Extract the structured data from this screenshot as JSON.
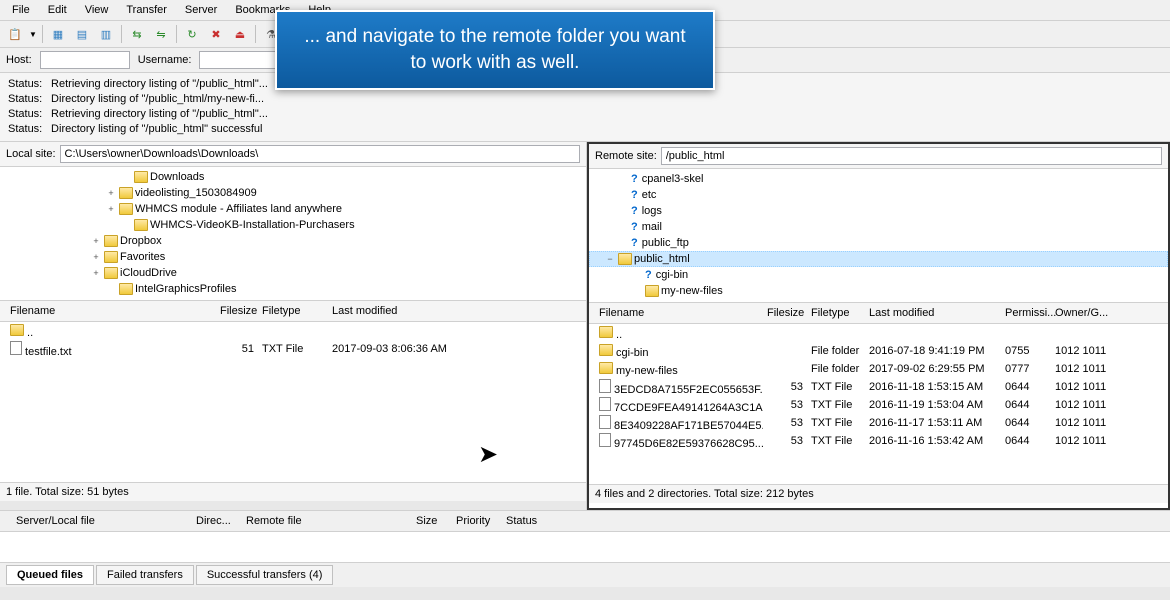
{
  "menu": {
    "file": "File",
    "edit": "Edit",
    "view": "View",
    "transfer": "Transfer",
    "server": "Server",
    "bookmarks": "Bookmarks",
    "help": "Help"
  },
  "qc": {
    "host_lbl": "Host:",
    "user_lbl": "Username:"
  },
  "log": [
    {
      "lbl": "Status:",
      "msg": "Retrieving directory listing of \"/public_html\"..."
    },
    {
      "lbl": "Status:",
      "msg": "Directory listing of \"/public_html/my-new-fi..."
    },
    {
      "lbl": "Status:",
      "msg": "Retrieving directory listing of \"/public_html\"..."
    },
    {
      "lbl": "Status:",
      "msg": "Directory listing of \"/public_html\" successful"
    }
  ],
  "local": {
    "path_lbl": "Local site:",
    "path": "C:\\Users\\owner\\Downloads\\Downloads\\",
    "tree": [
      {
        "indent": 120,
        "exp": "",
        "name": "Downloads"
      },
      {
        "indent": 105,
        "exp": "+",
        "name": "videolisting_1503084909"
      },
      {
        "indent": 105,
        "exp": "+",
        "name": "WHMCS module - Affiliates land anywhere"
      },
      {
        "indent": 120,
        "exp": "",
        "name": "WHMCS-VideoKB-Installation-Purchasers"
      },
      {
        "indent": 90,
        "exp": "+",
        "name": "Dropbox"
      },
      {
        "indent": 90,
        "exp": "+",
        "name": "Favorites"
      },
      {
        "indent": 90,
        "exp": "+",
        "name": "iCloudDrive"
      },
      {
        "indent": 105,
        "exp": "",
        "name": "IntelGraphicsProfiles"
      }
    ],
    "cols": {
      "name": "Filename",
      "size": "Filesize",
      "type": "Filetype",
      "mod": "Last modified"
    },
    "files": [
      {
        "name": "..",
        "size": "",
        "type": "",
        "mod": "",
        "icon": "folder"
      },
      {
        "name": "testfile.txt",
        "size": "51",
        "type": "TXT File",
        "mod": "2017-09-03 8:06:36 AM",
        "icon": "file"
      }
    ],
    "status": "1 file. Total size: 51 bytes"
  },
  "remote": {
    "path_lbl": "Remote site:",
    "path": "/public_html",
    "tree": [
      {
        "indent": 28,
        "exp": "",
        "q": true,
        "name": "cpanel3-skel"
      },
      {
        "indent": 28,
        "exp": "",
        "q": true,
        "name": "etc"
      },
      {
        "indent": 28,
        "exp": "",
        "q": true,
        "name": "logs"
      },
      {
        "indent": 28,
        "exp": "",
        "q": true,
        "name": "mail"
      },
      {
        "indent": 28,
        "exp": "",
        "q": true,
        "name": "public_ftp"
      },
      {
        "indent": 14,
        "exp": "−",
        "q": false,
        "name": "public_html",
        "sel": true
      },
      {
        "indent": 42,
        "exp": "",
        "q": true,
        "name": "cgi-bin"
      },
      {
        "indent": 42,
        "exp": "",
        "q": false,
        "name": "my-new-files"
      }
    ],
    "cols": {
      "name": "Filename",
      "size": "Filesize",
      "type": "Filetype",
      "mod": "Last modified",
      "perm": "Permissi...",
      "own": "Owner/G..."
    },
    "files": [
      {
        "name": "..",
        "size": "",
        "type": "",
        "mod": "",
        "perm": "",
        "own": "",
        "icon": "folder"
      },
      {
        "name": "cgi-bin",
        "size": "",
        "type": "File folder",
        "mod": "2016-07-18 9:41:19 PM",
        "perm": "0755",
        "own": "1012 1011",
        "icon": "folder"
      },
      {
        "name": "my-new-files",
        "size": "",
        "type": "File folder",
        "mod": "2017-09-02 6:29:55 PM",
        "perm": "0777",
        "own": "1012 1011",
        "icon": "folder"
      },
      {
        "name": "3EDCD8A7155F2EC055653F...",
        "size": "53",
        "type": "TXT File",
        "mod": "2016-11-18 1:53:15 AM",
        "perm": "0644",
        "own": "1012 1011",
        "icon": "file"
      },
      {
        "name": "7CCDE9FEA49141264A3C1A...",
        "size": "53",
        "type": "TXT File",
        "mod": "2016-11-19 1:53:04 AM",
        "perm": "0644",
        "own": "1012 1011",
        "icon": "file"
      },
      {
        "name": "8E3409228AF171BE57044E5...",
        "size": "53",
        "type": "TXT File",
        "mod": "2016-11-17 1:53:11 AM",
        "perm": "0644",
        "own": "1012 1011",
        "icon": "file"
      },
      {
        "name": "97745D6E82E59376628C95...",
        "size": "53",
        "type": "TXT File",
        "mod": "2016-11-16 1:53:42 AM",
        "perm": "0644",
        "own": "1012 1011",
        "icon": "file"
      }
    ],
    "status": "4 files and 2 directories. Total size: 212 bytes"
  },
  "queue": {
    "cols": {
      "srv": "Server/Local file",
      "dir": "Direc...",
      "rem": "Remote file",
      "size": "Size",
      "prio": "Priority",
      "stat": "Status"
    },
    "tabs": {
      "queued": "Queued files",
      "failed": "Failed transfers",
      "success": "Successful transfers (4)"
    }
  },
  "tip": "... and navigate to the remote folder you want to work with as well."
}
